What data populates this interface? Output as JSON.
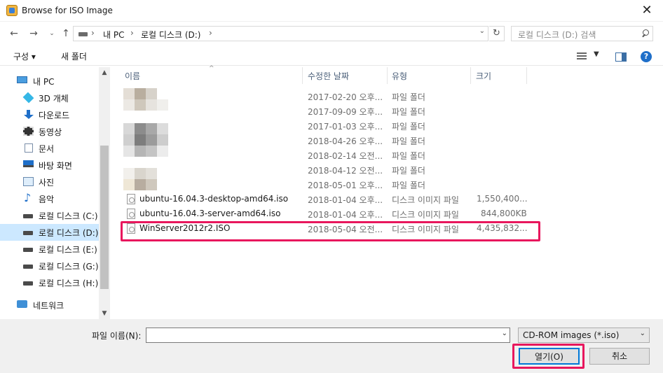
{
  "window": {
    "title": "Browse for ISO Image"
  },
  "address": {
    "crumbs": [
      "내 PC",
      "로컬 디스크 (D:)"
    ],
    "search_placeholder": "로컬 디스크 (D:) 검색"
  },
  "toolbar": {
    "organize": "구성 ▾",
    "new_folder": "새 폴더"
  },
  "sidebar": {
    "items": [
      {
        "label": "내 PC",
        "icon": "computer-icon"
      },
      {
        "label": "3D 개체",
        "icon": "3d-objects-icon"
      },
      {
        "label": "다운로드",
        "icon": "download-icon"
      },
      {
        "label": "동영상",
        "icon": "video-icon"
      },
      {
        "label": "문서",
        "icon": "document-icon"
      },
      {
        "label": "바탕 화면",
        "icon": "desktop-icon"
      },
      {
        "label": "사진",
        "icon": "pictures-icon"
      },
      {
        "label": "음악",
        "icon": "music-icon"
      },
      {
        "label": "로컬 디스크 (C:)",
        "icon": "drive-icon"
      },
      {
        "label": "로컬 디스크 (D:)",
        "icon": "drive-icon",
        "selected": true
      },
      {
        "label": "로컬 디스크 (E:)",
        "icon": "drive-icon"
      },
      {
        "label": "로컬 디스크 (G:)",
        "icon": "drive-icon"
      },
      {
        "label": "로컬 디스크 (H:)",
        "icon": "drive-icon"
      },
      {
        "label": "네트워크",
        "icon": "network-icon"
      }
    ]
  },
  "columns": {
    "name": "이름",
    "modified": "수정한 날짜",
    "type": "유형",
    "size": "크기"
  },
  "files": [
    {
      "name": "",
      "date": "2017-02-20 오후...",
      "type": "파일 폴더",
      "size": ""
    },
    {
      "name": "",
      "date": "2017-09-09 오후...",
      "type": "파일 폴더",
      "size": ""
    },
    {
      "name": "",
      "date": "2017-01-03 오후...",
      "type": "파일 폴더",
      "size": ""
    },
    {
      "name": "",
      "date": "2018-04-26 오후...",
      "type": "파일 폴더",
      "size": ""
    },
    {
      "name": "",
      "date": "2018-02-14 오전...",
      "type": "파일 폴더",
      "size": ""
    },
    {
      "name": "",
      "date": "2018-04-12 오전...",
      "type": "파일 폴더",
      "size": ""
    },
    {
      "name": "",
      "date": "2018-05-01 오후...",
      "type": "파일 폴더",
      "size": ""
    },
    {
      "name": "ubuntu-16.04.3-desktop-amd64.iso",
      "date": "2018-01-04 오후...",
      "type": "디스크 이미지 파일",
      "size": "1,550,400..."
    },
    {
      "name": "ubuntu-16.04.3-server-amd64.iso",
      "date": "2018-01-04 오후...",
      "type": "디스크 이미지 파일",
      "size": "844,800KB"
    },
    {
      "name": "WinServer2012r2.ISO",
      "date": "2018-05-04 오전...",
      "type": "디스크 이미지 파일",
      "size": "4,435,832..."
    }
  ],
  "bottom": {
    "filename_label": "파일 이름(N):",
    "filename_value": "",
    "filter": "CD-ROM images (*.iso)",
    "open": "열기(O)",
    "cancel": "취소"
  }
}
